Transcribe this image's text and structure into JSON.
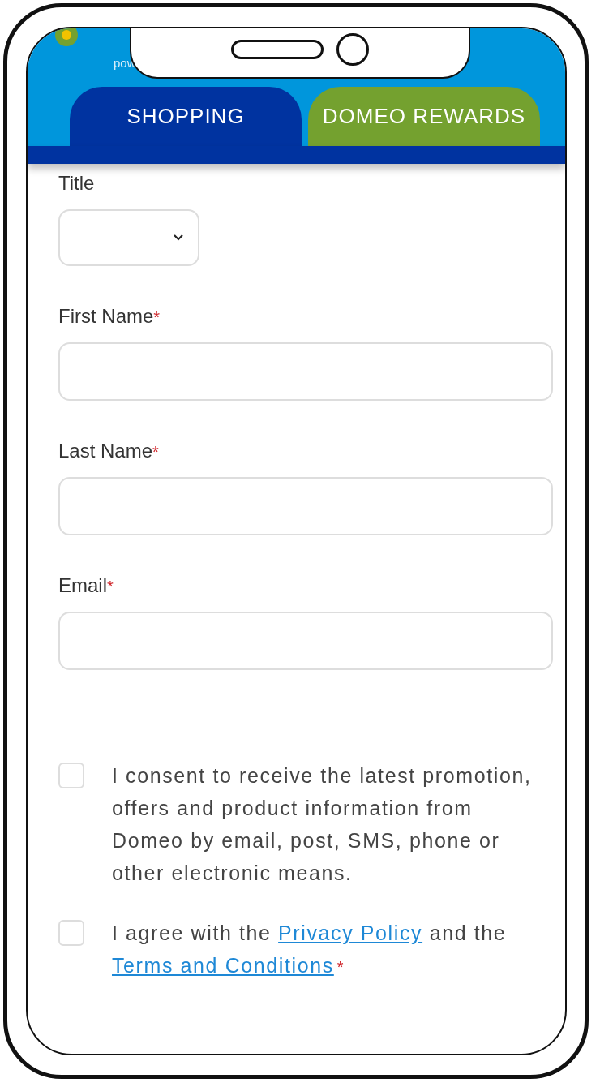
{
  "header": {
    "logo_caption": "pow"
  },
  "tabs": [
    {
      "label": "SHOPPING",
      "selected": true
    },
    {
      "label": "DOMEO REWARDS",
      "selected": false
    }
  ],
  "form": {
    "fields": [
      {
        "kind": "select",
        "label": "Title"
      },
      {
        "kind": "text",
        "label": "First Name",
        "required_mark": "*"
      },
      {
        "kind": "text",
        "label": "Last Name",
        "required_mark": "*"
      },
      {
        "kind": "text",
        "label": "Email",
        "required_mark": "*"
      }
    ],
    "consents": [
      {
        "checked": false,
        "parts": [
          {
            "text": "I consent to receive the latest promotion, offers and product information from Domeo by email, post, SMS, phone or other electronic means."
          }
        ]
      },
      {
        "checked": false,
        "parts": [
          {
            "text": "I agree with the "
          },
          {
            "text": "Privacy Policy",
            "link": true
          },
          {
            "text": " and the "
          },
          {
            "text": "Terms and Conditions",
            "link": true
          }
        ],
        "required_mark": "*"
      }
    ]
  }
}
